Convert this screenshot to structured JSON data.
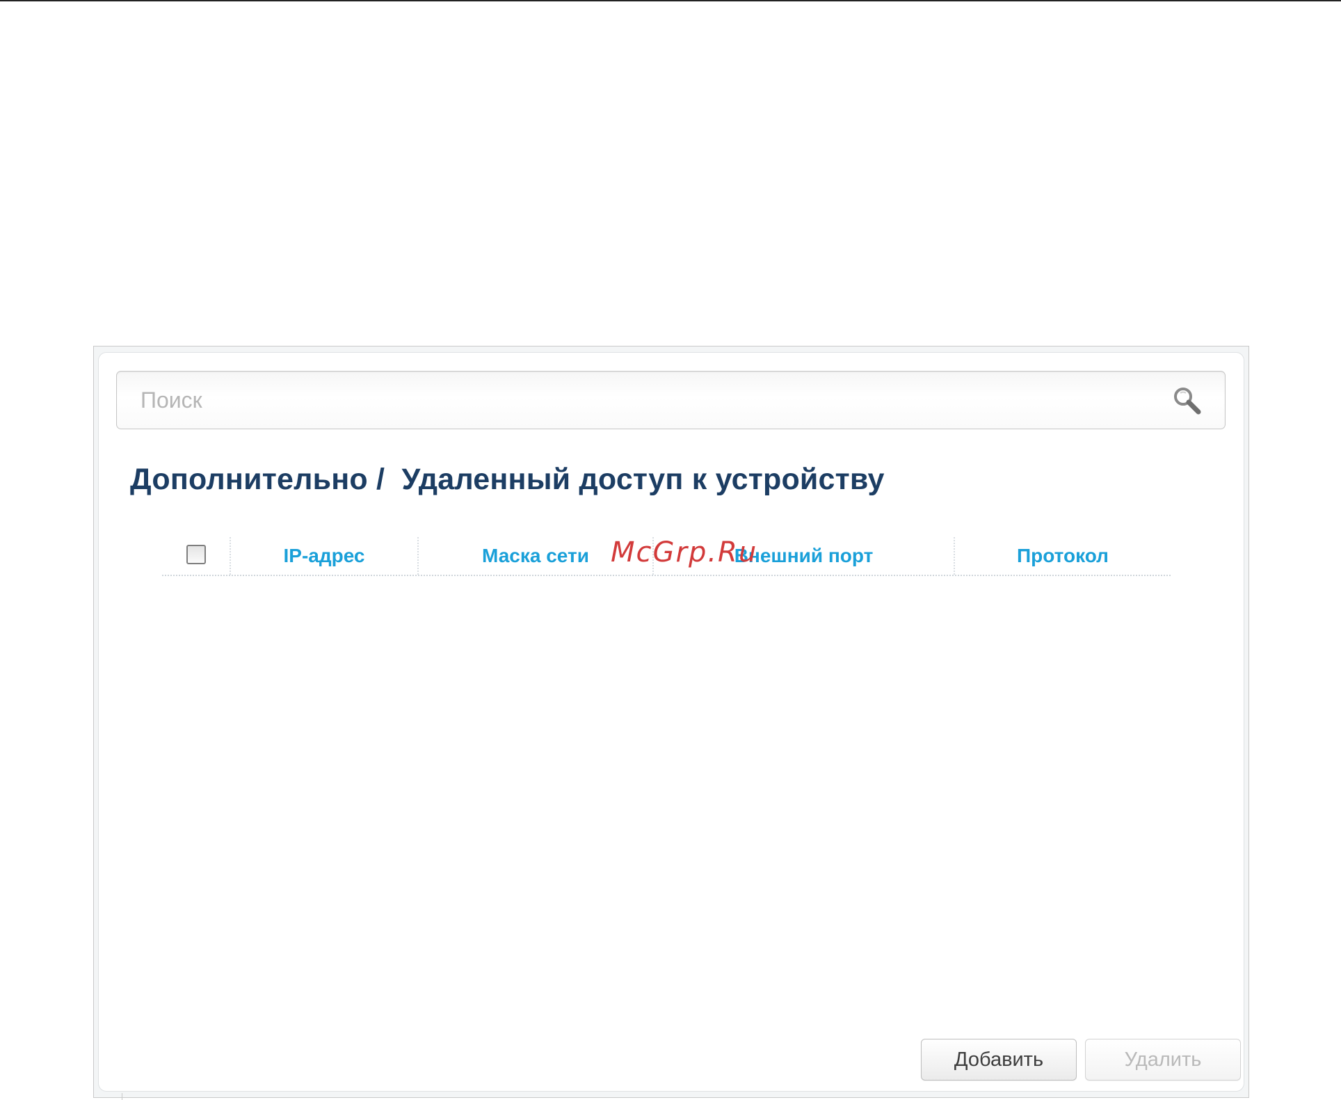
{
  "search": {
    "placeholder": "Поиск",
    "icon": "search-icon"
  },
  "page": {
    "title": "Дополнительно /  Удаленный доступ к устройству"
  },
  "table": {
    "select_all_checked": false,
    "columns": [
      "IP-адрес",
      "Маска сети",
      "Внешний порт",
      "Протокол"
    ],
    "rows": []
  },
  "watermark": "McGrp.Ru",
  "buttons": {
    "add_label": "Добавить",
    "delete_label": "Удалить",
    "delete_disabled": true
  },
  "colors": {
    "title": "#1c3d63",
    "column_header": "#1aa0d9",
    "watermark": "#d23a3a"
  }
}
